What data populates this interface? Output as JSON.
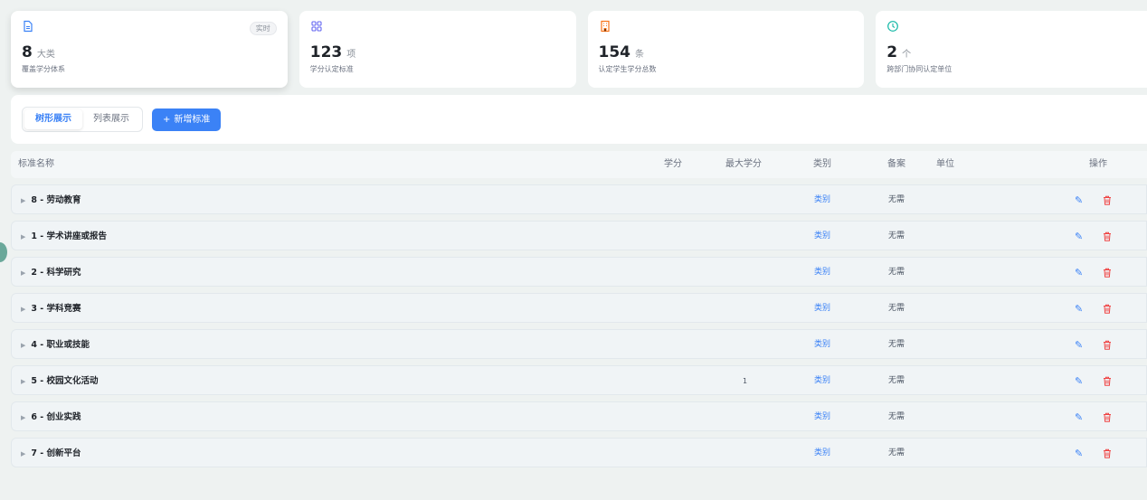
{
  "stats": [
    {
      "num": "8",
      "unit": "大类",
      "desc": "覆盖学分体系",
      "badge": "实时",
      "icon": "document-icon",
      "color": "#3b82f6"
    },
    {
      "num": "123",
      "unit": "项",
      "desc": "学分认定标准",
      "icon": "grid-icon",
      "color": "#6366f1"
    },
    {
      "num": "154",
      "unit": "条",
      "desc": "认定学生学分总数",
      "icon": "building-icon",
      "color": "#f97316"
    },
    {
      "num": "2",
      "unit": "个",
      "desc": "跨部门协同认定单位",
      "icon": "clock-icon",
      "color": "#14b8a6"
    }
  ],
  "toolbar": {
    "tree_view": "树形展示",
    "list_view": "列表展示",
    "add_label": "新增标准",
    "add_icon": "+"
  },
  "table": {
    "headers": {
      "name": "标准名称",
      "credit": "学分",
      "max_credit": "最大学分",
      "category": "类别",
      "filing": "备案",
      "unit": "单位",
      "actions": "操作"
    },
    "rows": [
      {
        "name": "8 - 劳动教育",
        "credit": "",
        "max_credit": "",
        "category": "类别",
        "filing": "无需",
        "unit": ""
      },
      {
        "name": "1 - 学术讲座或报告",
        "credit": "",
        "max_credit": "",
        "category": "类别",
        "filing": "无需",
        "unit": ""
      },
      {
        "name": "2 - 科学研究",
        "credit": "",
        "max_credit": "",
        "category": "类别",
        "filing": "无需",
        "unit": ""
      },
      {
        "name": "3 - 学科竞赛",
        "credit": "",
        "max_credit": "",
        "category": "类别",
        "filing": "无需",
        "unit": ""
      },
      {
        "name": "4 - 职业或技能",
        "credit": "",
        "max_credit": "",
        "category": "类别",
        "filing": "无需",
        "unit": ""
      },
      {
        "name": "5 - 校园文化活动",
        "credit": "",
        "max_credit": "1",
        "category": "类别",
        "filing": "无需",
        "unit": ""
      },
      {
        "name": "6 - 创业实践",
        "credit": "",
        "max_credit": "",
        "category": "类别",
        "filing": "无需",
        "unit": ""
      },
      {
        "name": "7 - 创新平台",
        "credit": "",
        "max_credit": "",
        "category": "类别",
        "filing": "无需",
        "unit": ""
      }
    ],
    "expand_icon": "▶",
    "edit_icon": "✎",
    "edit_color": "#3b82f6",
    "delete_color": "#ef4444"
  }
}
